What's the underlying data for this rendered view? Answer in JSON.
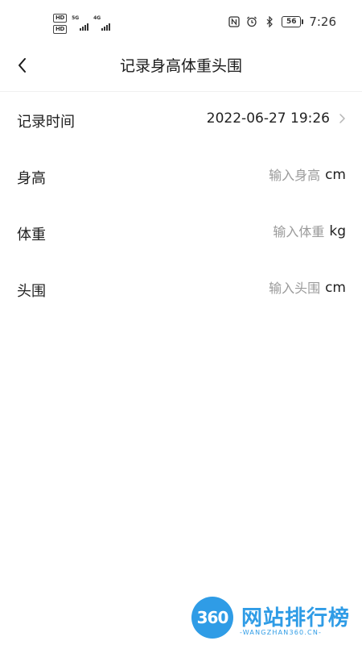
{
  "status_bar": {
    "hd_badge_1": "HD",
    "hd_badge_2": "HD",
    "net_1": "5G",
    "net_2": "4G",
    "battery_level": "56",
    "time": "7:26"
  },
  "header": {
    "title": "记录身高体重头围"
  },
  "rows": {
    "record_time": {
      "label": "记录时间",
      "value": "2022-06-27 19:26"
    },
    "height": {
      "label": "身高",
      "placeholder": "输入身高",
      "value": "",
      "unit": "cm"
    },
    "weight": {
      "label": "体重",
      "placeholder": "输入体重",
      "value": "",
      "unit": "kg"
    },
    "head_circumference": {
      "label": "头围",
      "placeholder": "输入头围",
      "value": "",
      "unit": "cm"
    }
  },
  "watermark": {
    "badge": "360",
    "name": "网站排行榜",
    "domain": "-WANGZHAN360.CN-"
  },
  "colors": {
    "text": "#1f1f1f",
    "placeholder": "#9a9a9a",
    "watermark": "#2f9ce6"
  }
}
